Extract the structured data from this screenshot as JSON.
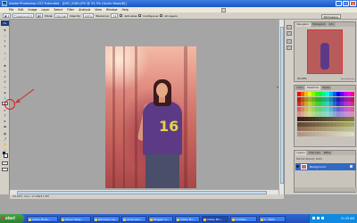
{
  "window": {
    "title": "Adobe Photoshop CS3 Extended - [DSC_0081.JPG @ 33.3% (Quick Mask/8)]",
    "app_icon": "Ps"
  },
  "menu": [
    "File",
    "Edit",
    "Image",
    "Layer",
    "Select",
    "Filter",
    "Analysis",
    "View",
    "Window",
    "Help"
  ],
  "options_bar": {
    "mode_label": "Mode:",
    "mode_value": "Normal",
    "opacity_label": "Opacity:",
    "opacity_value": "100%",
    "tolerance_label": "Tolerance:",
    "tolerance_value": "32",
    "anti_alias": "Anti-alias",
    "contiguous": "Contiguous",
    "all_layers": "All Layers",
    "workspace": "Workspace"
  },
  "toolbox": {
    "logo": "Ps",
    "tools": [
      "move",
      "marquee",
      "lasso",
      "magic-wand",
      "crop",
      "slice",
      "healing",
      "brush",
      "clone-stamp",
      "history-brush",
      "eraser",
      "paint-bucket",
      "blur",
      "dodge",
      "pen",
      "type",
      "path-selection",
      "shape",
      "notes",
      "eyedropper",
      "hand",
      "zoom"
    ]
  },
  "panels": {
    "navigator_tabs": [
      "Navigator",
      "Histogram",
      "Info"
    ],
    "navigator_zoom": "33.33%",
    "swatches_tabs": [
      "Color",
      "Swatches",
      "Styles"
    ],
    "layers_tabs": [
      "Layers",
      "Channels",
      "Paths"
    ],
    "layers_opts": "Normal   Opacity: 100%",
    "layer_name": "Background"
  },
  "status": {
    "zoom": "33.33%",
    "doc": "Doc: 17.2M/17.2M"
  },
  "taskbar": {
    "start": "start",
    "tasks": [
      "Adobe Photo...",
      "Yahoo! Mess...",
      "Windows Live...",
      "(Unknown)...",
      "Blogger: C...",
      "Adobe Bri...",
      "Adobe Pho...",
      "Untitled...",
      "2 - Paint"
    ],
    "clock": "11:29 AM"
  },
  "colors": {
    "titlebar": "#1a55c7",
    "annotation": "#d81e1e",
    "quick_mask_tint": "#e79a8c"
  }
}
